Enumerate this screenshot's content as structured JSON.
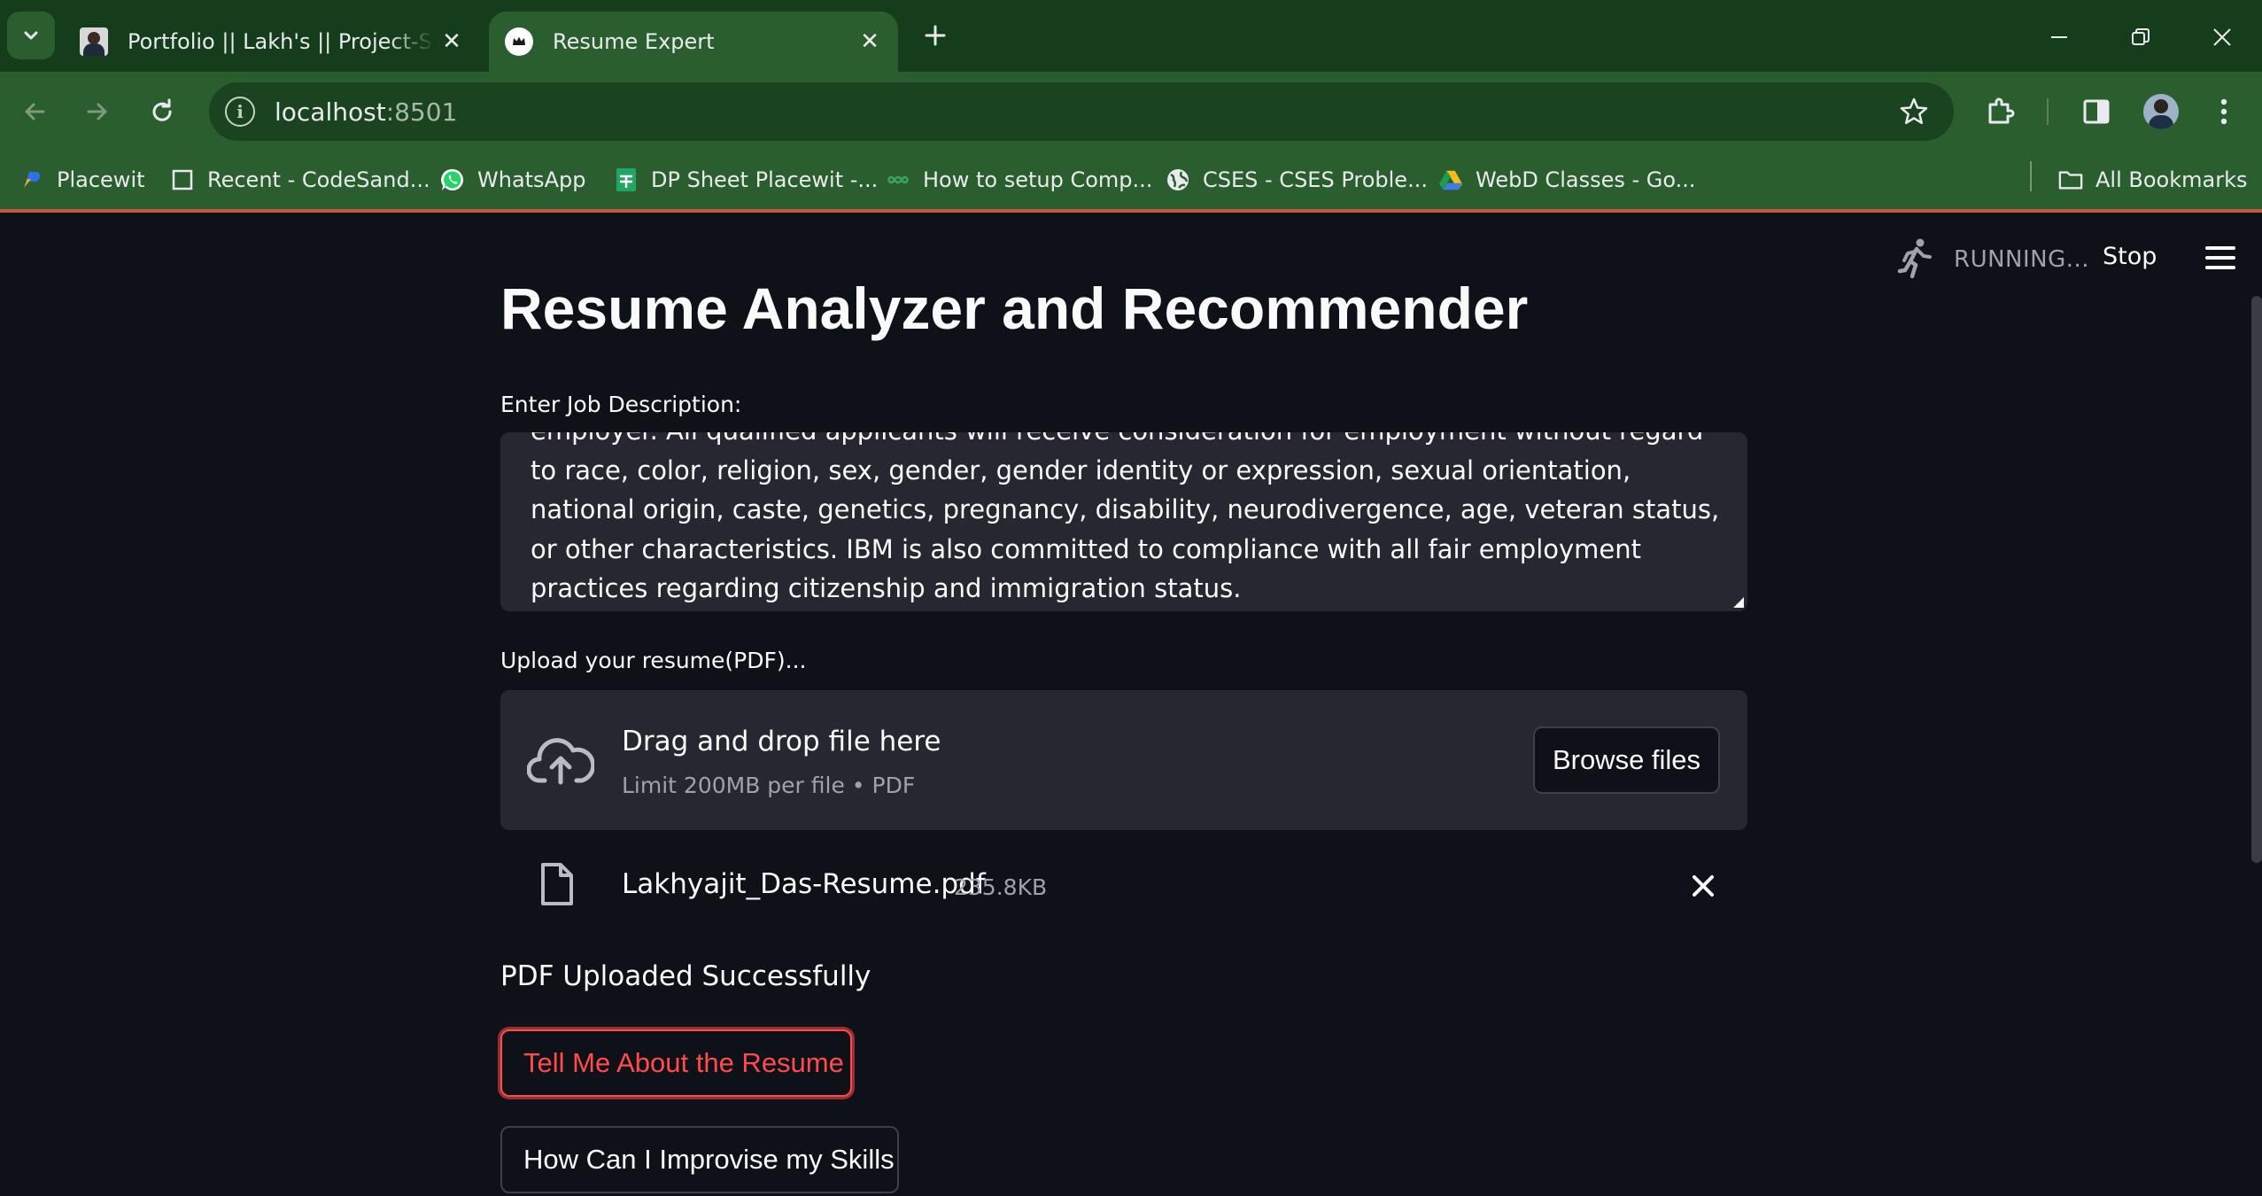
{
  "browser": {
    "tabs": [
      {
        "title": "Portfolio || Lakh's || Project-Section",
        "active": false
      },
      {
        "title": "Resume Expert",
        "active": true
      }
    ],
    "address": {
      "host": "localhost",
      "port": ":8501"
    },
    "bookmarks": [
      {
        "label": "Placewit",
        "icon": "placewit-icon"
      },
      {
        "label": "Recent - CodeSand...",
        "icon": "codesandbox-icon"
      },
      {
        "label": "WhatsApp",
        "icon": "whatsapp-icon"
      },
      {
        "label": "DP Sheet Placewit -...",
        "icon": "sheets-icon"
      },
      {
        "label": "How to setup Comp...",
        "icon": "link-icon"
      },
      {
        "label": "CSES - CSES Proble...",
        "icon": "globe-icon"
      },
      {
        "label": "WebD Classes - Go...",
        "icon": "drive-icon"
      }
    ],
    "all_bookmarks": "All Bookmarks"
  },
  "app": {
    "status": {
      "running_text": "RUNNING...",
      "stop_label": "Stop"
    },
    "title": "Resume Analyzer and Recommender",
    "job_description": {
      "label": "Enter Job Description:",
      "value": "employer. All qualified applicants will receive consideration for employment without regard to race, color, religion, sex, gender, gender identity or expression, sexual orientation, national origin, caste, genetics, pregnancy, disability, neurodivergence, age, veteran status, or other characteristics. IBM is also committed to compliance with all fair employment practices regarding citizenship and immigration status."
    },
    "uploader": {
      "label": "Upload your resume(PDF)...",
      "drag_text": "Drag and drop file here",
      "limit_text": "Limit 200MB per file • PDF",
      "browse_label": "Browse files",
      "file": {
        "name": "Lakhyajit_Das-Resume.pdf",
        "size": "235.8KB"
      }
    },
    "success_message": "PDF Uploaded Successfully",
    "buttons": {
      "tell_me": "Tell Me About the Resume",
      "improve": "How Can I Improvise my Skills"
    }
  },
  "colors": {
    "tabbar_bg": "#163d1b",
    "toolbar_bg": "#2b5e2e",
    "app_bg": "#0e1117",
    "input_bg": "#262730",
    "accent_red": "#ff4b4b"
  }
}
